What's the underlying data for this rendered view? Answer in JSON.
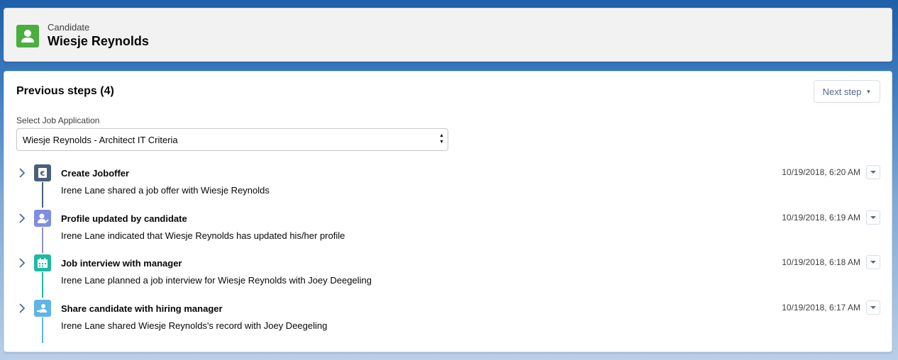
{
  "record": {
    "type_label": "Candidate",
    "name": "Wiesje Reynolds",
    "avatar_color": "#4bae3f"
  },
  "steps_card": {
    "title": "Previous steps (4)",
    "next_step_label": "Next step",
    "select_label": "Select Job Application",
    "select_value": "Wiesje Reynolds - Architect IT Criteria"
  },
  "timeline": [
    {
      "title": "Create Joboffer",
      "description": "Irene Lane shared a job offer with Wiesje Reynolds",
      "date": "10/19/2018, 6:20 AM",
      "icon": "euro-document-icon",
      "color": "#4a5f7c",
      "line_color": "#4a5f7c"
    },
    {
      "title": "Profile updated by candidate",
      "description": "Irene Lane indicated that Wiesje Reynolds has updated his/her profile",
      "date": "10/19/2018, 6:19 AM",
      "icon": "user-check-icon",
      "color": "#7f8de1",
      "line_color": "#8b93c4"
    },
    {
      "title": "Job interview with manager",
      "description": "Irene Lane planned a job interview for Wiesje Reynolds with Joey Deegeling",
      "date": "10/19/2018, 6:18 AM",
      "icon": "calendar-icon",
      "color": "#1fb8a4",
      "line_color": "#1fb8a4"
    },
    {
      "title": "Share candidate with hiring manager",
      "description": "Irene Lane shared Wiesje Reynolds's record with Joey Deegeling",
      "date": "10/19/2018, 6:17 AM",
      "icon": "share-user-icon",
      "color": "#5fb4e8",
      "line_color": "#5fb4e8"
    }
  ]
}
